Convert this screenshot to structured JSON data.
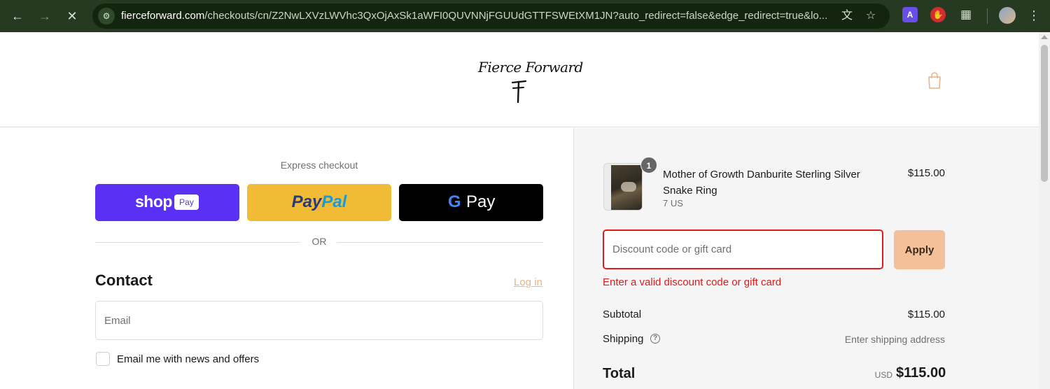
{
  "browser": {
    "url_host": "fierceforward.com",
    "url_path": "/checkouts/cn/Z2NwLXVzLWVhc3QxOjAxSk1aWFI0QUVNNjFGUUdGTTFSWEtXM1JN?auto_redirect=false&edge_redirect=true&lo..."
  },
  "header": {
    "logo_text": "Fierce Forward"
  },
  "express": {
    "label": "Express checkout",
    "shop_pay_text": "shop",
    "shop_pay_badge": "Pay",
    "paypal_pay": "Pay",
    "paypal_pal": "Pal",
    "gpay_g": "G",
    "gpay_text": "Pay",
    "or_text": "OR"
  },
  "contact": {
    "title": "Contact",
    "login_link": "Log in",
    "email_placeholder": "Email",
    "newsletter_label": "Email me with news and offers"
  },
  "summary": {
    "item": {
      "quantity": "1",
      "name": "Mother of Growth Danburite Sterling Silver Snake Ring",
      "variant": "7 US",
      "price": "$115.00"
    },
    "discount_placeholder": "Discount code or gift card",
    "apply_label": "Apply",
    "error_message": "Enter a valid discount code or gift card",
    "subtotal_label": "Subtotal",
    "subtotal_value": "$115.00",
    "shipping_label": "Shipping",
    "shipping_value": "Enter shipping address",
    "total_label": "Total",
    "total_currency": "USD",
    "total_value": "$115.00"
  },
  "colors": {
    "chrome_bg": "#253a21",
    "shop_pay": "#5a31f4",
    "paypal": "#f2bb36",
    "gpay": "#000000",
    "accent": "#f3c09a",
    "error": "#dd1d1d"
  }
}
